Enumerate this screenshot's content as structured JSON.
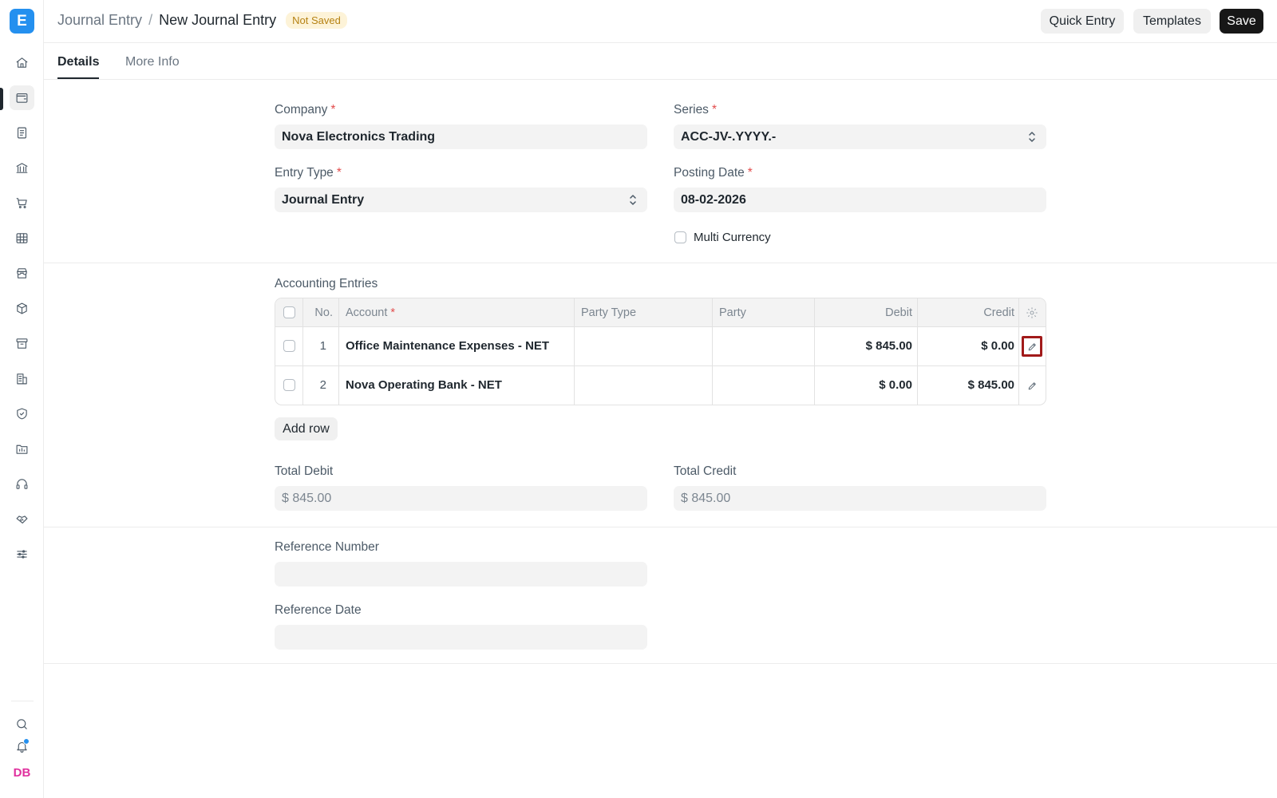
{
  "app": {
    "logo_letter": "E"
  },
  "sidebar": {
    "items": [
      {
        "icon": "home-icon"
      },
      {
        "icon": "wallet-icon",
        "active": true
      },
      {
        "icon": "document-icon"
      },
      {
        "icon": "bank-icon"
      },
      {
        "icon": "cart-icon"
      },
      {
        "icon": "table-icon"
      },
      {
        "icon": "store-icon"
      },
      {
        "icon": "package-icon"
      },
      {
        "icon": "archive-icon"
      },
      {
        "icon": "building-icon"
      },
      {
        "icon": "shield-icon"
      },
      {
        "icon": "folder-chart-icon"
      },
      {
        "icon": "headset-icon"
      },
      {
        "icon": "handshake-icon"
      },
      {
        "icon": "sliders-icon"
      }
    ],
    "avatar_initials": "DB"
  },
  "header": {
    "breadcrumb_parent": "Journal Entry",
    "breadcrumb_separator": "/",
    "title": "New Journal Entry",
    "status_badge": "Not Saved",
    "quick_entry_label": "Quick Entry",
    "templates_label": "Templates",
    "save_label": "Save"
  },
  "tabs": [
    {
      "label": "Details",
      "active": true
    },
    {
      "label": "More Info",
      "active": false
    }
  ],
  "form": {
    "company": {
      "label": "Company",
      "value": "Nova Electronics Trading"
    },
    "series": {
      "label": "Series",
      "value": "ACC-JV-.YYYY.-"
    },
    "entry_type": {
      "label": "Entry Type",
      "value": "Journal Entry"
    },
    "posting_date": {
      "label": "Posting Date",
      "value": "08-02-2026"
    },
    "multi_currency": {
      "label": "Multi Currency",
      "checked": false
    },
    "required_mark": "*"
  },
  "accounting_entries": {
    "section_label": "Accounting Entries",
    "columns": {
      "no": "No.",
      "account": "Account",
      "party_type": "Party Type",
      "party": "Party",
      "debit": "Debit",
      "credit": "Credit"
    },
    "rows": [
      {
        "no": "1",
        "account": "Office Maintenance Expenses - NET",
        "party_type": "",
        "party": "",
        "debit": "$ 845.00",
        "credit": "$ 0.00"
      },
      {
        "no": "2",
        "account": "Nova Operating Bank - NET",
        "party_type": "",
        "party": "",
        "debit": "$ 0.00",
        "credit": "$ 845.00"
      }
    ],
    "add_row_label": "Add row"
  },
  "totals": {
    "total_debit": {
      "label": "Total Debit",
      "value": "$ 845.00"
    },
    "total_credit": {
      "label": "Total Credit",
      "value": "$ 845.00"
    }
  },
  "reference": {
    "number": {
      "label": "Reference Number",
      "value": ""
    },
    "date": {
      "label": "Reference Date",
      "value": ""
    }
  }
}
